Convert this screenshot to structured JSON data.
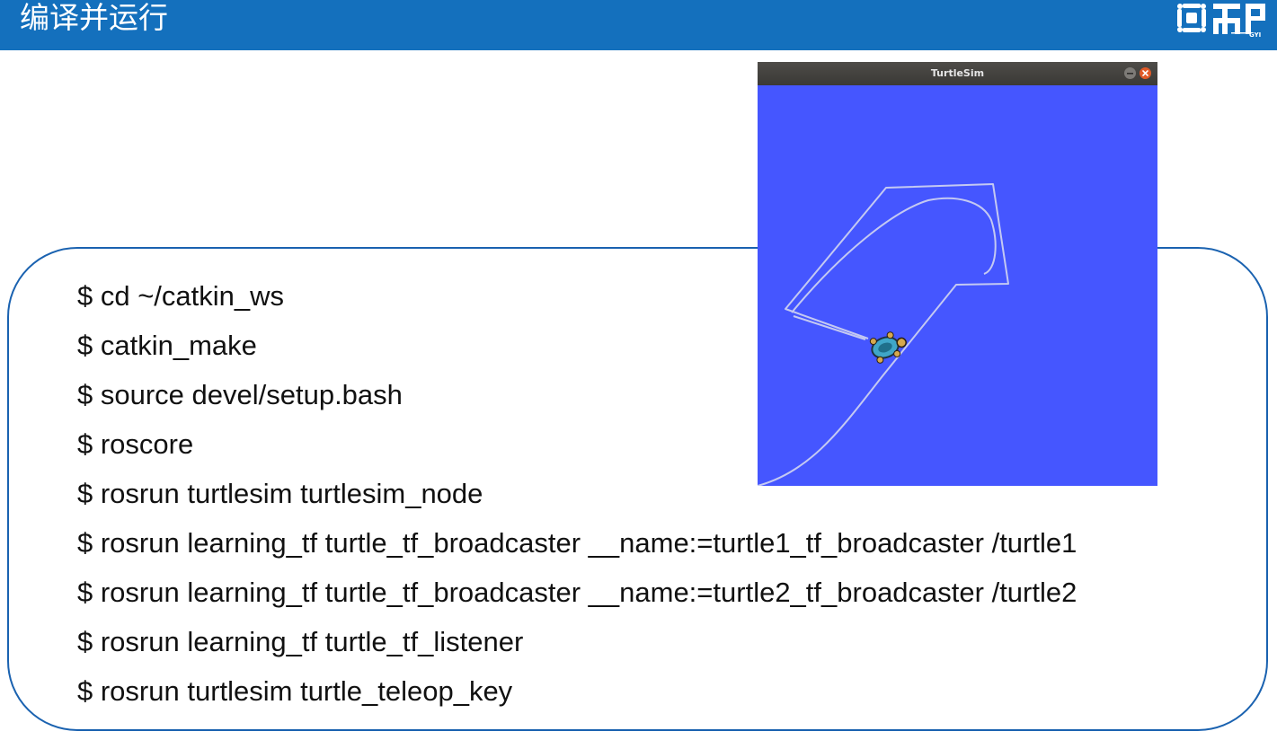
{
  "header": {
    "title": "编译并运行",
    "accent_color": "#1470bd"
  },
  "logo": {
    "icon": "logo-icon",
    "caption": "GYI"
  },
  "turtlesim": {
    "window_title": "TurtleSim",
    "background_color": "#4556ff",
    "icons": [
      "minimize-icon",
      "close-icon",
      "turtle-icon"
    ]
  },
  "commands": [
    "$ cd ~/catkin_ws",
    "$ catkin_make",
    "$ source devel/setup.bash",
    "$ roscore",
    "$ rosrun turtlesim turtlesim_node",
    "$ rosrun learning_tf turtle_tf_broadcaster __name:=turtle1_tf_broadcaster /turtle1",
    "$ rosrun learning_tf turtle_tf_broadcaster __name:=turtle2_tf_broadcaster /turtle2",
    "$ rosrun learning_tf turtle_tf_listener",
    "$ rosrun turtlesim turtle_teleop_key"
  ]
}
